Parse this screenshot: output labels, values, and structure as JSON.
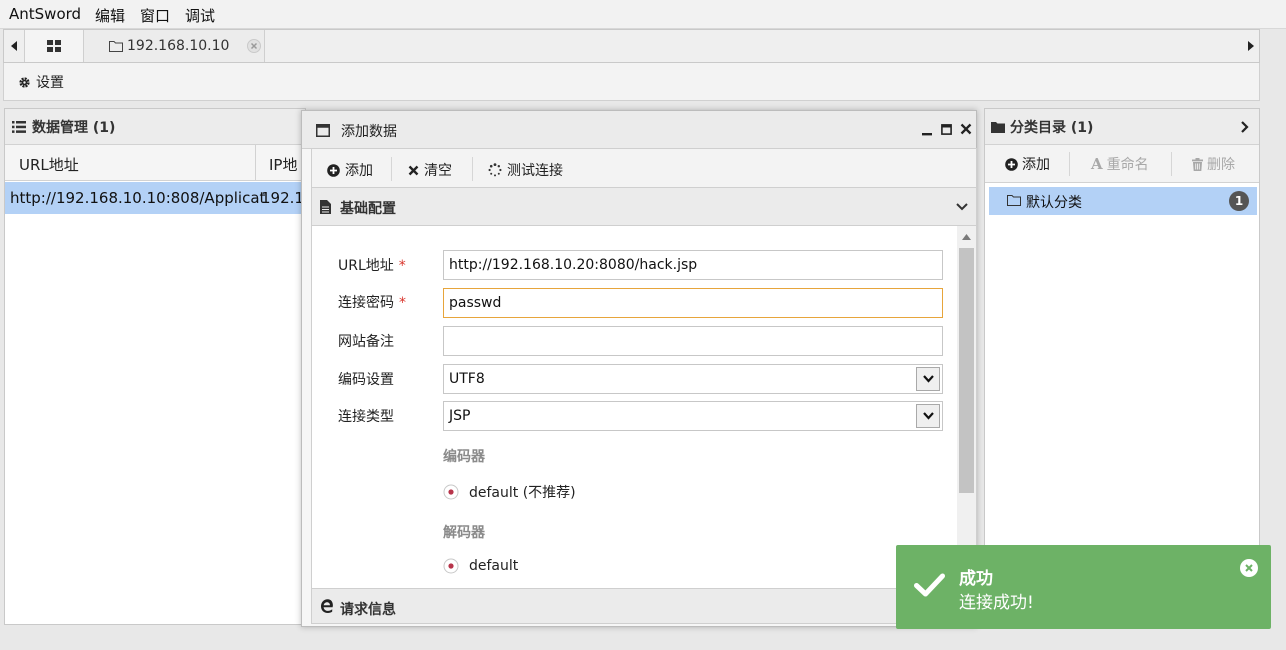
{
  "menubar": {
    "items": [
      "AntSword",
      "编辑",
      "窗口",
      "调试"
    ]
  },
  "tabs": {
    "home_icon": "grid-icon",
    "host_tab": "192.168.10.10"
  },
  "toolbar": {
    "settings_label": "设置"
  },
  "data_manager": {
    "title": "数据管理 (1)",
    "columns": [
      "URL地址",
      "IP地"
    ],
    "rows": [
      {
        "url": "http://192.168.10.10:808/Applicat",
        "ip": "192.1"
      }
    ]
  },
  "dialog": {
    "title": "添加数据",
    "toolbar": {
      "add": "添加",
      "clear": "清空",
      "test": "测试连接"
    },
    "basic_section": "基础配置",
    "request_section": "请求信息",
    "fields": {
      "url_label": "URL地址",
      "url_value": "http://192.168.10.20:8080/hack.jsp",
      "password_label": "连接密码",
      "password_value": "passwd",
      "note_label": "网站备注",
      "note_value": "",
      "encoding_label": "编码设置",
      "encoding_value": "UTF8",
      "type_label": "连接类型",
      "type_value": "JSP",
      "encoder_label": "编码器",
      "encoder_option": "default (不推荐)",
      "decoder_label": "解码器",
      "decoder_option": "default",
      "required_mark": "*"
    }
  },
  "category_panel": {
    "title": "分类目录 (1)",
    "toolbar": {
      "add": "添加",
      "rename": "重命名",
      "delete": "删除"
    },
    "items": [
      {
        "label": "默认分类",
        "count": "1"
      }
    ]
  },
  "toast": {
    "title": "成功",
    "message": "连接成功!",
    "color": "#6db266"
  }
}
